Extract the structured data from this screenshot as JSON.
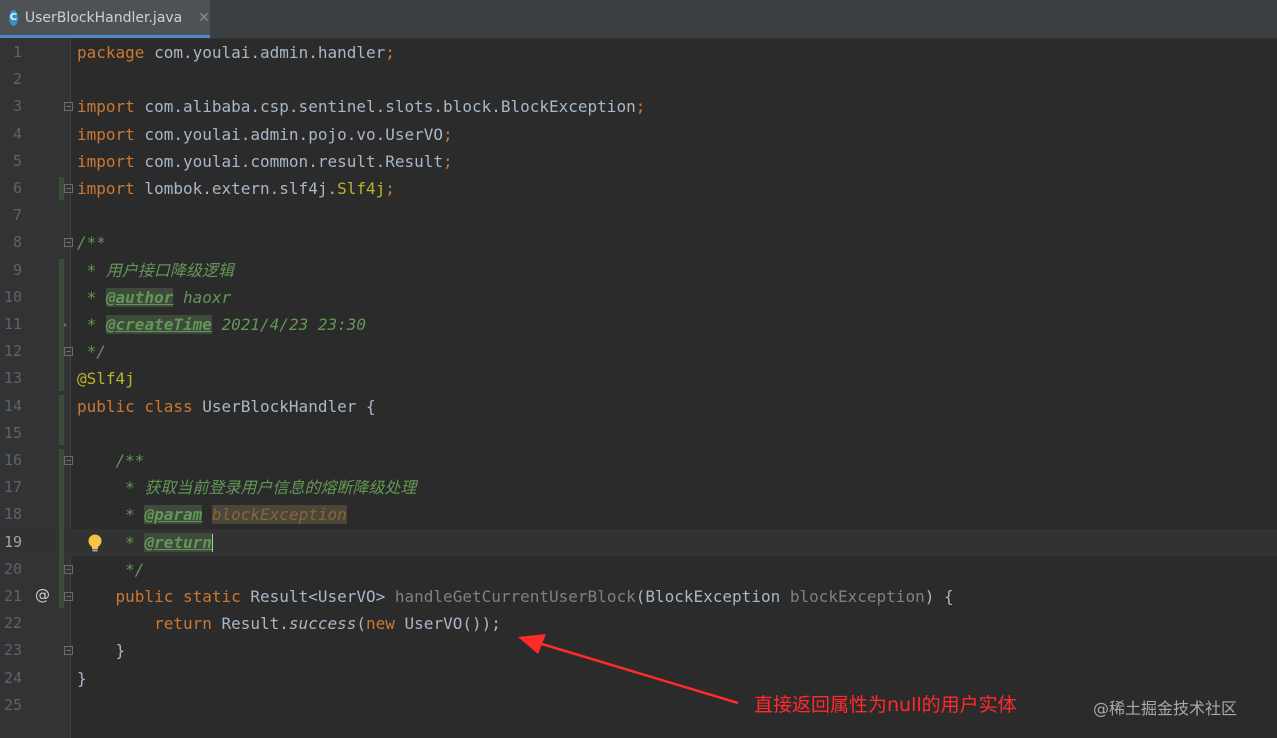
{
  "tab": {
    "icon_letter": "C",
    "file_name": "UserBlockHandler.java",
    "close": "✕"
  },
  "lines": [
    {
      "n": "1",
      "tokens": [
        [
          "kw",
          "package"
        ],
        [
          "t",
          " com.youlai.admin.handler"
        ],
        [
          "kw",
          ";"
        ]
      ]
    },
    {
      "n": "2",
      "tokens": []
    },
    {
      "n": "3",
      "tokens": [
        [
          "kw",
          "import"
        ],
        [
          "t",
          " com.alibaba.csp.sentinel.slots.block.BlockException"
        ],
        [
          "kw",
          ";"
        ]
      ]
    },
    {
      "n": "4",
      "tokens": [
        [
          "kw",
          "import"
        ],
        [
          "t",
          " com.youlai.admin.pojo.vo.UserVO"
        ],
        [
          "kw",
          ";"
        ]
      ]
    },
    {
      "n": "5",
      "tokens": [
        [
          "kw",
          "import"
        ],
        [
          "t",
          " com.youlai.common.result.Result"
        ],
        [
          "kw",
          ";"
        ]
      ]
    },
    {
      "n": "6",
      "tokens": [
        [
          "kw",
          "import"
        ],
        [
          "t",
          " lombok.extern.slf4j."
        ],
        [
          "ann",
          "Slf4j"
        ],
        [
          "kw",
          ";"
        ]
      ]
    },
    {
      "n": "7",
      "tokens": []
    },
    {
      "n": "8",
      "tokens": [
        [
          "doc",
          "/**"
        ]
      ]
    },
    {
      "n": "9",
      "tokens": [
        [
          "doc",
          " * 用户接口降级逻辑"
        ]
      ]
    },
    {
      "n": "10",
      "tokens": [
        [
          "doc",
          " * "
        ],
        [
          "doctag",
          "@author"
        ],
        [
          "doc",
          " haoxr"
        ]
      ]
    },
    {
      "n": "11",
      "tokens": [
        [
          "doc",
          " * "
        ],
        [
          "doctag",
          "@createTime"
        ],
        [
          "doc",
          " 2021/4/23 23:30"
        ]
      ]
    },
    {
      "n": "12",
      "tokens": [
        [
          "doc",
          " */"
        ]
      ]
    },
    {
      "n": "13",
      "tokens": [
        [
          "ann",
          "@Slf4j"
        ]
      ]
    },
    {
      "n": "14",
      "tokens": [
        [
          "kw",
          "public class"
        ],
        [
          "t",
          " UserBlockHandler {"
        ]
      ]
    },
    {
      "n": "15",
      "tokens": []
    },
    {
      "n": "16",
      "tokens": [
        [
          "doc",
          "    /**"
        ]
      ]
    },
    {
      "n": "17",
      "tokens": [
        [
          "doc",
          "     * 获取当前登录用户信息的熔断降级处理"
        ]
      ]
    },
    {
      "n": "18",
      "tokens": [
        [
          "doc",
          "     * "
        ],
        [
          "doctag",
          "@param"
        ],
        [
          "doc",
          " "
        ],
        [
          "docparam",
          "blockException"
        ]
      ]
    },
    {
      "n": "19",
      "tokens": [
        [
          "doc",
          "     * "
        ],
        [
          "doctag",
          "@return"
        ],
        [
          "caret",
          ""
        ]
      ]
    },
    {
      "n": "20",
      "tokens": [
        [
          "doc",
          "     */"
        ]
      ]
    },
    {
      "n": "21",
      "tokens": [
        [
          "kw",
          "    public static"
        ],
        [
          "t",
          " Result<UserVO> "
        ],
        [
          "param-unused",
          "handleGetCurrentUserBlock"
        ],
        [
          "t",
          "(BlockException "
        ],
        [
          "param-unused",
          "blockException"
        ],
        [
          "t",
          ") {"
        ]
      ]
    },
    {
      "n": "22",
      "tokens": [
        [
          "kw",
          "        return"
        ],
        [
          "t",
          " Result."
        ],
        [
          "static-call",
          "success"
        ],
        [
          "t",
          "("
        ],
        [
          "kw",
          "new"
        ],
        [
          "t",
          " UserVO());"
        ]
      ]
    },
    {
      "n": "23",
      "tokens": [
        [
          "t",
          "    }"
        ]
      ]
    },
    {
      "n": "24",
      "tokens": [
        [
          "t",
          "}"
        ]
      ]
    },
    {
      "n": "25",
      "tokens": []
    }
  ],
  "overlay": {
    "annotation": "直接返回属性为null的用户实体",
    "watermark": "@稀土掘金技术社区"
  },
  "colors": {
    "background": "#2b2b2b",
    "keyword": "#cc7832",
    "annotation": "#bbb529",
    "doc_comment": "#629755",
    "text": "#a9b7c6",
    "arrow": "#ff2a2a"
  }
}
